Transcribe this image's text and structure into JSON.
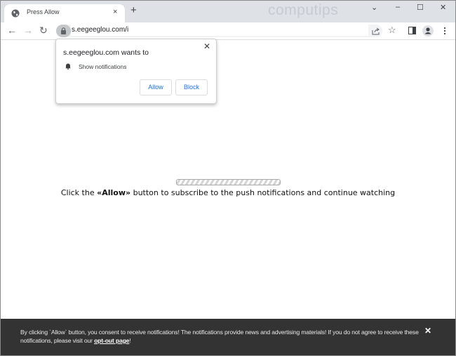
{
  "browser": {
    "tab": {
      "title": "Press Allow",
      "favicon": "globe-icon",
      "close_glyph": "×"
    },
    "new_tab_glyph": "+",
    "watermark": "computips",
    "window_controls": {
      "dropdown": "⌄",
      "minimize": "–",
      "maximize": "☐",
      "close": "✕"
    },
    "nav": {
      "back": "←",
      "forward": "→",
      "reload": "↻"
    },
    "url": "s.eegeeglou.com/i",
    "toolbar_icons": [
      "share-icon",
      "star-icon",
      "side-panel-icon",
      "profile-icon",
      "menu-icon"
    ]
  },
  "permission_popup": {
    "title": "s.eegeeglou.com wants to",
    "permission": "Show notifications",
    "allow_label": "Allow",
    "block_label": "Block",
    "close_glyph": "✕"
  },
  "page": {
    "progress_state": "indeterminate",
    "message_prefix": "Click the ",
    "message_bold": "«Allow»",
    "message_suffix": " button to subscribe to the push notifications and continue watching"
  },
  "banner": {
    "text_before": "By clicking `Allow` button, you consent to receive notifications! The notifications provide news and advertising materials! If you do not agree to receive these notifications, please visit our ",
    "link_text": "opt-out page",
    "text_after": "!",
    "close_glyph": "✕"
  }
}
